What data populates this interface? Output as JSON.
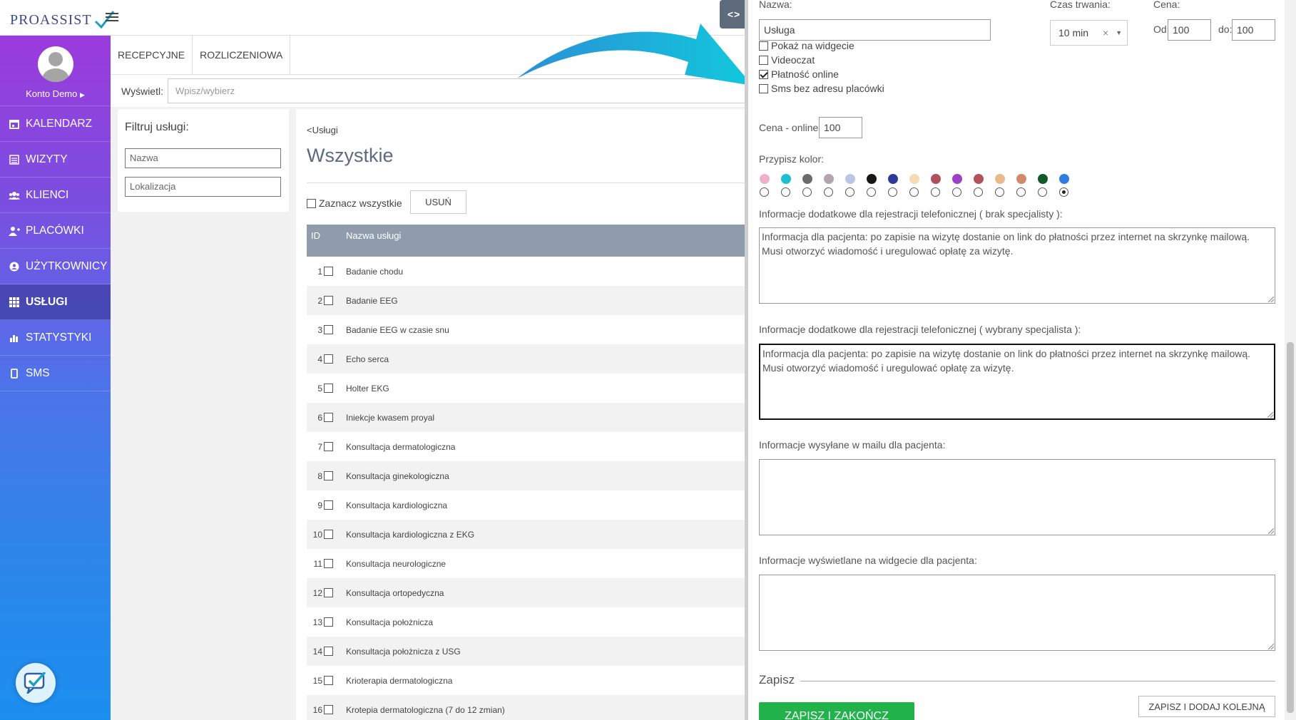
{
  "header": {
    "logo_text": "PROASSIST"
  },
  "sidebar": {
    "profile_name": "Konto Demo",
    "items": [
      {
        "label": "KALENDARZ",
        "icon": "calendar-icon"
      },
      {
        "label": "WIZYTY",
        "icon": "list-icon"
      },
      {
        "label": "KLIENCI",
        "icon": "users-icon"
      },
      {
        "label": "PLACÓWKI",
        "icon": "user-plus-icon"
      },
      {
        "label": "UŻYTKOWNICY",
        "icon": "user-circle-icon"
      },
      {
        "label": "USŁUGI",
        "icon": "grid-icon"
      },
      {
        "label": "STATYSTYKI",
        "icon": "bar-chart-icon"
      },
      {
        "label": "SMS",
        "icon": "phone-icon"
      }
    ],
    "active_index": 5
  },
  "main": {
    "tabs": [
      "RECEPCYJNE",
      "ROZLICZENIOWA"
    ],
    "show_label": "Wyświetl:",
    "show_placeholder": "Wpisz/wybierz",
    "filter": {
      "title": "Filtruj usługi:",
      "name_placeholder": "Nazwa",
      "location_placeholder": "Lokalizacja"
    },
    "back_link": "<Usługi",
    "page_title": "Wszystkie",
    "select_all_label": "Zaznacz wszystkie",
    "delete_label": "USUŃ",
    "table": {
      "headers": [
        "ID",
        "Nazwa usługi"
      ],
      "rows": [
        {
          "id": "1",
          "name": "Badanie chodu"
        },
        {
          "id": "2",
          "name": "Badanie EEG"
        },
        {
          "id": "3",
          "name": "Badanie EEG w czasie snu"
        },
        {
          "id": "4",
          "name": "Echo serca"
        },
        {
          "id": "5",
          "name": "Holter EKG"
        },
        {
          "id": "6",
          "name": "Iniekcje kwasem proyal"
        },
        {
          "id": "7",
          "name": "Konsultacja dermatologiczna"
        },
        {
          "id": "8",
          "name": "Konsultacja ginekologiczna"
        },
        {
          "id": "9",
          "name": "Konsultacja kardiologiczna"
        },
        {
          "id": "10",
          "name": "Konsultacja kardiologiczna z EKG"
        },
        {
          "id": "11",
          "name": "Konsultacja neurologiczne"
        },
        {
          "id": "12",
          "name": "Konsultacja ortopedyczna"
        },
        {
          "id": "13",
          "name": "Konsultacja położnicza"
        },
        {
          "id": "14",
          "name": "Konsultacja położnicza z USG"
        },
        {
          "id": "15",
          "name": "Krioterapia dermatologiczna"
        },
        {
          "id": "16",
          "name": "Krotepia dermatologiczna (7 do 12 zmian)"
        }
      ]
    }
  },
  "panel": {
    "expander_label": "<>",
    "name_label": "Nazwa:",
    "name_value": "Usługa",
    "duration_label": "Czas trwania:",
    "duration_value": "10 min",
    "duration_clear": "×",
    "price_label": "Cena:",
    "price_from_label": "Od:",
    "price_from_value": "100",
    "price_to_label": "do:",
    "price_to_value": "100",
    "checkboxes": [
      {
        "label": "Pokaż na widgecie",
        "checked": false
      },
      {
        "label": "Videoczat",
        "checked": false
      },
      {
        "label": "Płatność online",
        "checked": true
      },
      {
        "label": "Sms bez adresu placówki",
        "checked": false
      }
    ],
    "online_price_label": "Cena - online:",
    "online_price_value": "100",
    "color_label": "Przypisz kolor:",
    "colors": [
      "#eab1c8",
      "#1bbfd0",
      "#6b6b6b",
      "#b2a6ac",
      "#b9c6e6",
      "#1b1616",
      "#2e3a9a",
      "#f6dbb5",
      "#b14f5c",
      "#9c40c8",
      "#b2505c",
      "#e9b98a",
      "#d08a6a",
      "#0f5a2a",
      "#2f7de0"
    ],
    "selected_color_index": 14,
    "info_phone_no_specialist_label": "Informacje dodatkowe dla rejestracji telefonicznej ( brak specjalisty ):",
    "info_phone_no_specialist_value": "Informacja dla pacjenta: po zapisie na wizytę dostanie on link do płatności przez internet na skrzynkę mailową. Musi otworzyć wiadomość i uregulować opłatę za wizytę.",
    "info_phone_specialist_label": "Informacje dodatkowe dla rejestracji telefonicznej ( wybrany specjalista ):",
    "info_phone_specialist_value": "Informacja dla pacjenta: po zapisie na wizytę dostanie on link do płatności przez internet na skrzynkę mailową. Musi otworzyć wiadomość i uregulować opłatę za wizytę.",
    "info_mail_label": "Informacje wysyłane w mailu dla pacjenta:",
    "info_widget_label": "Informacje wyświetlane na widgecie dla pacjenta:",
    "save_legend": "Zapisz",
    "save_finish_label": "ZAPISZ I ZAKOŃCZ",
    "save_add_label": "ZAPISZ I DODAJ KOLEJNĄ"
  }
}
